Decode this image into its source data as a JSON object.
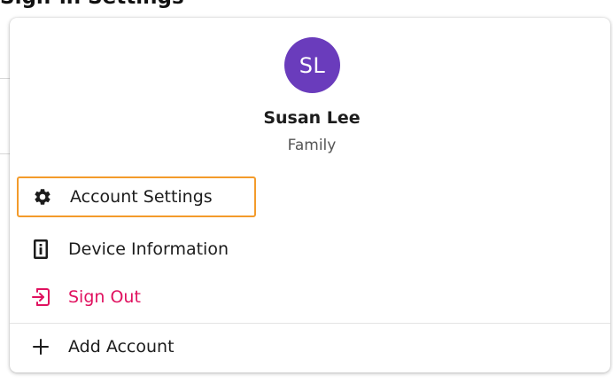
{
  "page": {
    "background_title": "Sign-in Settings"
  },
  "profile": {
    "initials": "SL",
    "name": "Susan Lee",
    "plan": "Family",
    "avatar_color": "#6a3cbc"
  },
  "menu": {
    "items": [
      {
        "label": "Account Settings",
        "icon": "gear-icon",
        "highlighted": true,
        "highlight_color": "#f39b2b"
      },
      {
        "label": "Device Information",
        "icon": "device-info-icon"
      },
      {
        "label": "Sign Out",
        "icon": "sign-out-icon",
        "color": "#e0115f"
      },
      {
        "label": "Add Account",
        "icon": "plus-icon"
      }
    ]
  }
}
